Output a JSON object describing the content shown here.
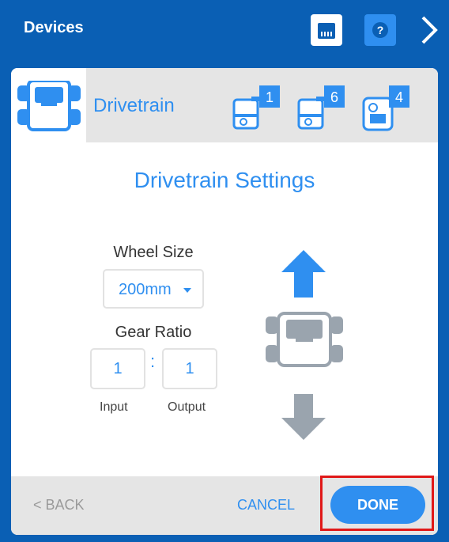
{
  "header": {
    "title": "Devices",
    "port_icon": "brain-port-icon",
    "help_icon": "help-icon",
    "next_icon": "chevron-right-icon",
    "bg_color": "#0a5fb4"
  },
  "device_bar": {
    "active_label": "Drivetrain",
    "active_icon": "drivetrain-icon",
    "devices": [
      {
        "icon": "motor-device-icon",
        "port": "1"
      },
      {
        "icon": "motor-device-icon",
        "port": "6"
      },
      {
        "icon": "gyro-device-icon",
        "port": "4"
      }
    ]
  },
  "settings": {
    "title": "Drivetrain Settings",
    "wheel_size_label": "Wheel Size",
    "wheel_size_value": "200mm",
    "gear_ratio_label": "Gear Ratio",
    "gear_ratio_separator": ":",
    "input_value": "1",
    "output_value": "1",
    "input_label": "Input",
    "output_label": "Output"
  },
  "preview": {
    "forward_icon": "arrow-up-icon",
    "robot_icon": "drivetrain-icon",
    "reverse_icon": "arrow-down-icon"
  },
  "footer": {
    "back_label": "< BACK",
    "cancel_label": "CANCEL",
    "done_label": "DONE"
  },
  "colors": {
    "accent": "#2f8ff0",
    "highlight": "#e01818",
    "disabled": "#9a9a9a"
  }
}
